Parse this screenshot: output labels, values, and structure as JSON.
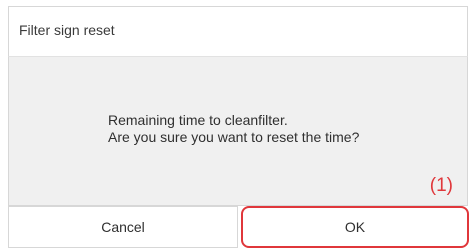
{
  "dialog": {
    "title": "Filter sign reset",
    "message_line1": "Remaining time to cleanfilter.",
    "message_line2": "Are you sure you want to reset the time?",
    "marker": "(1)",
    "cancel_label": "Cancel",
    "ok_label": "OK"
  },
  "colors": {
    "highlight": "#e0373b",
    "panel_background": "#f0f0f0"
  }
}
